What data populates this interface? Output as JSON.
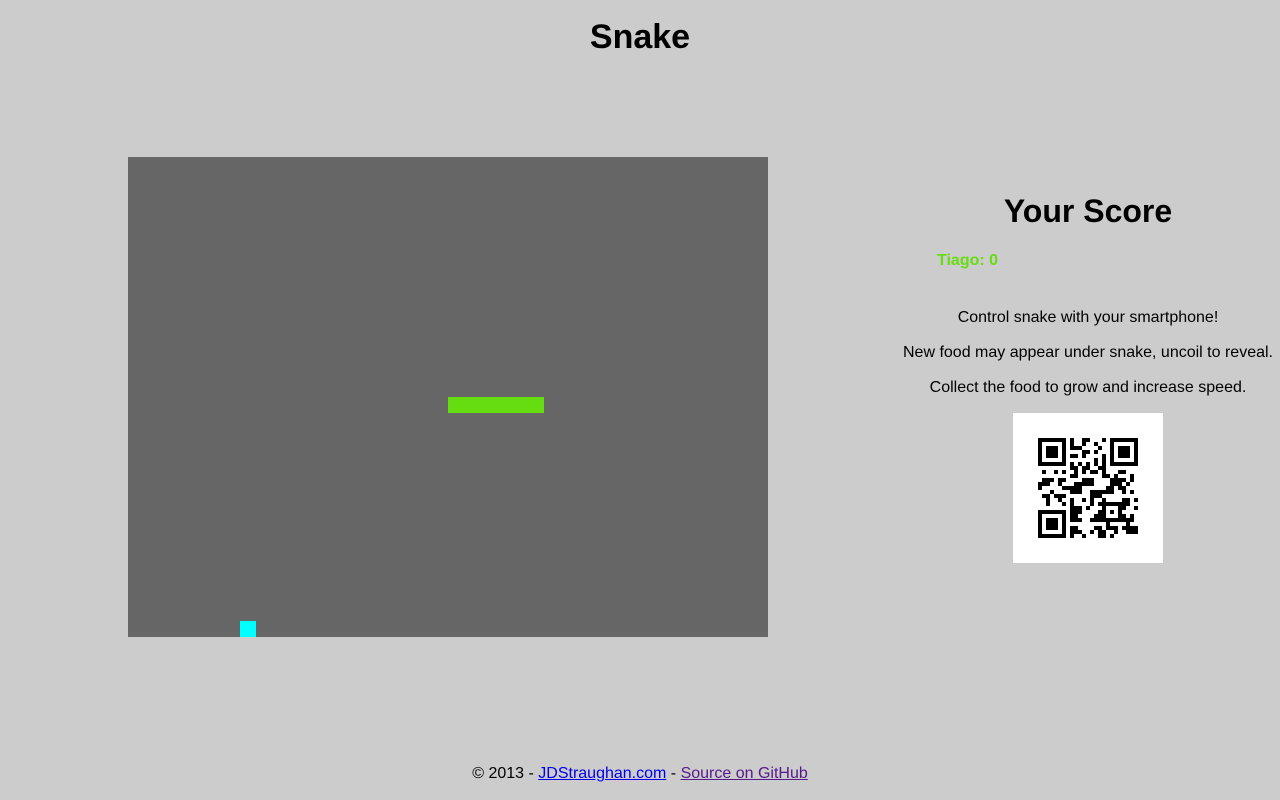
{
  "title": "Snake",
  "colors": {
    "background": "#cccccc",
    "board": "#666666",
    "snake": "#66dd11",
    "food": "#00ffff",
    "player": "#66dd11",
    "link": "#0000ee",
    "link_visited": "#551a8b"
  },
  "game": {
    "cols": 40,
    "rows": 30,
    "snake": [
      [
        20,
        15
      ],
      [
        21,
        15
      ],
      [
        22,
        15
      ],
      [
        23,
        15
      ],
      [
        24,
        15
      ],
      [
        25,
        15
      ]
    ],
    "food": [
      [
        7,
        29
      ]
    ]
  },
  "score_panel": {
    "heading": "Your Score",
    "players": [
      {
        "name": "Tiago",
        "separator": ": ",
        "score": "0"
      }
    ],
    "instructions": [
      "Control snake with your smartphone!",
      "New food may appear under snake, uncoil to reveal.",
      "Collect the food to grow and increase speed."
    ]
  },
  "footer": {
    "copyright": "© 2013 - ",
    "site_link": "JDStraughan.com",
    "separator": " - ",
    "source_link": "Source on GitHub"
  }
}
